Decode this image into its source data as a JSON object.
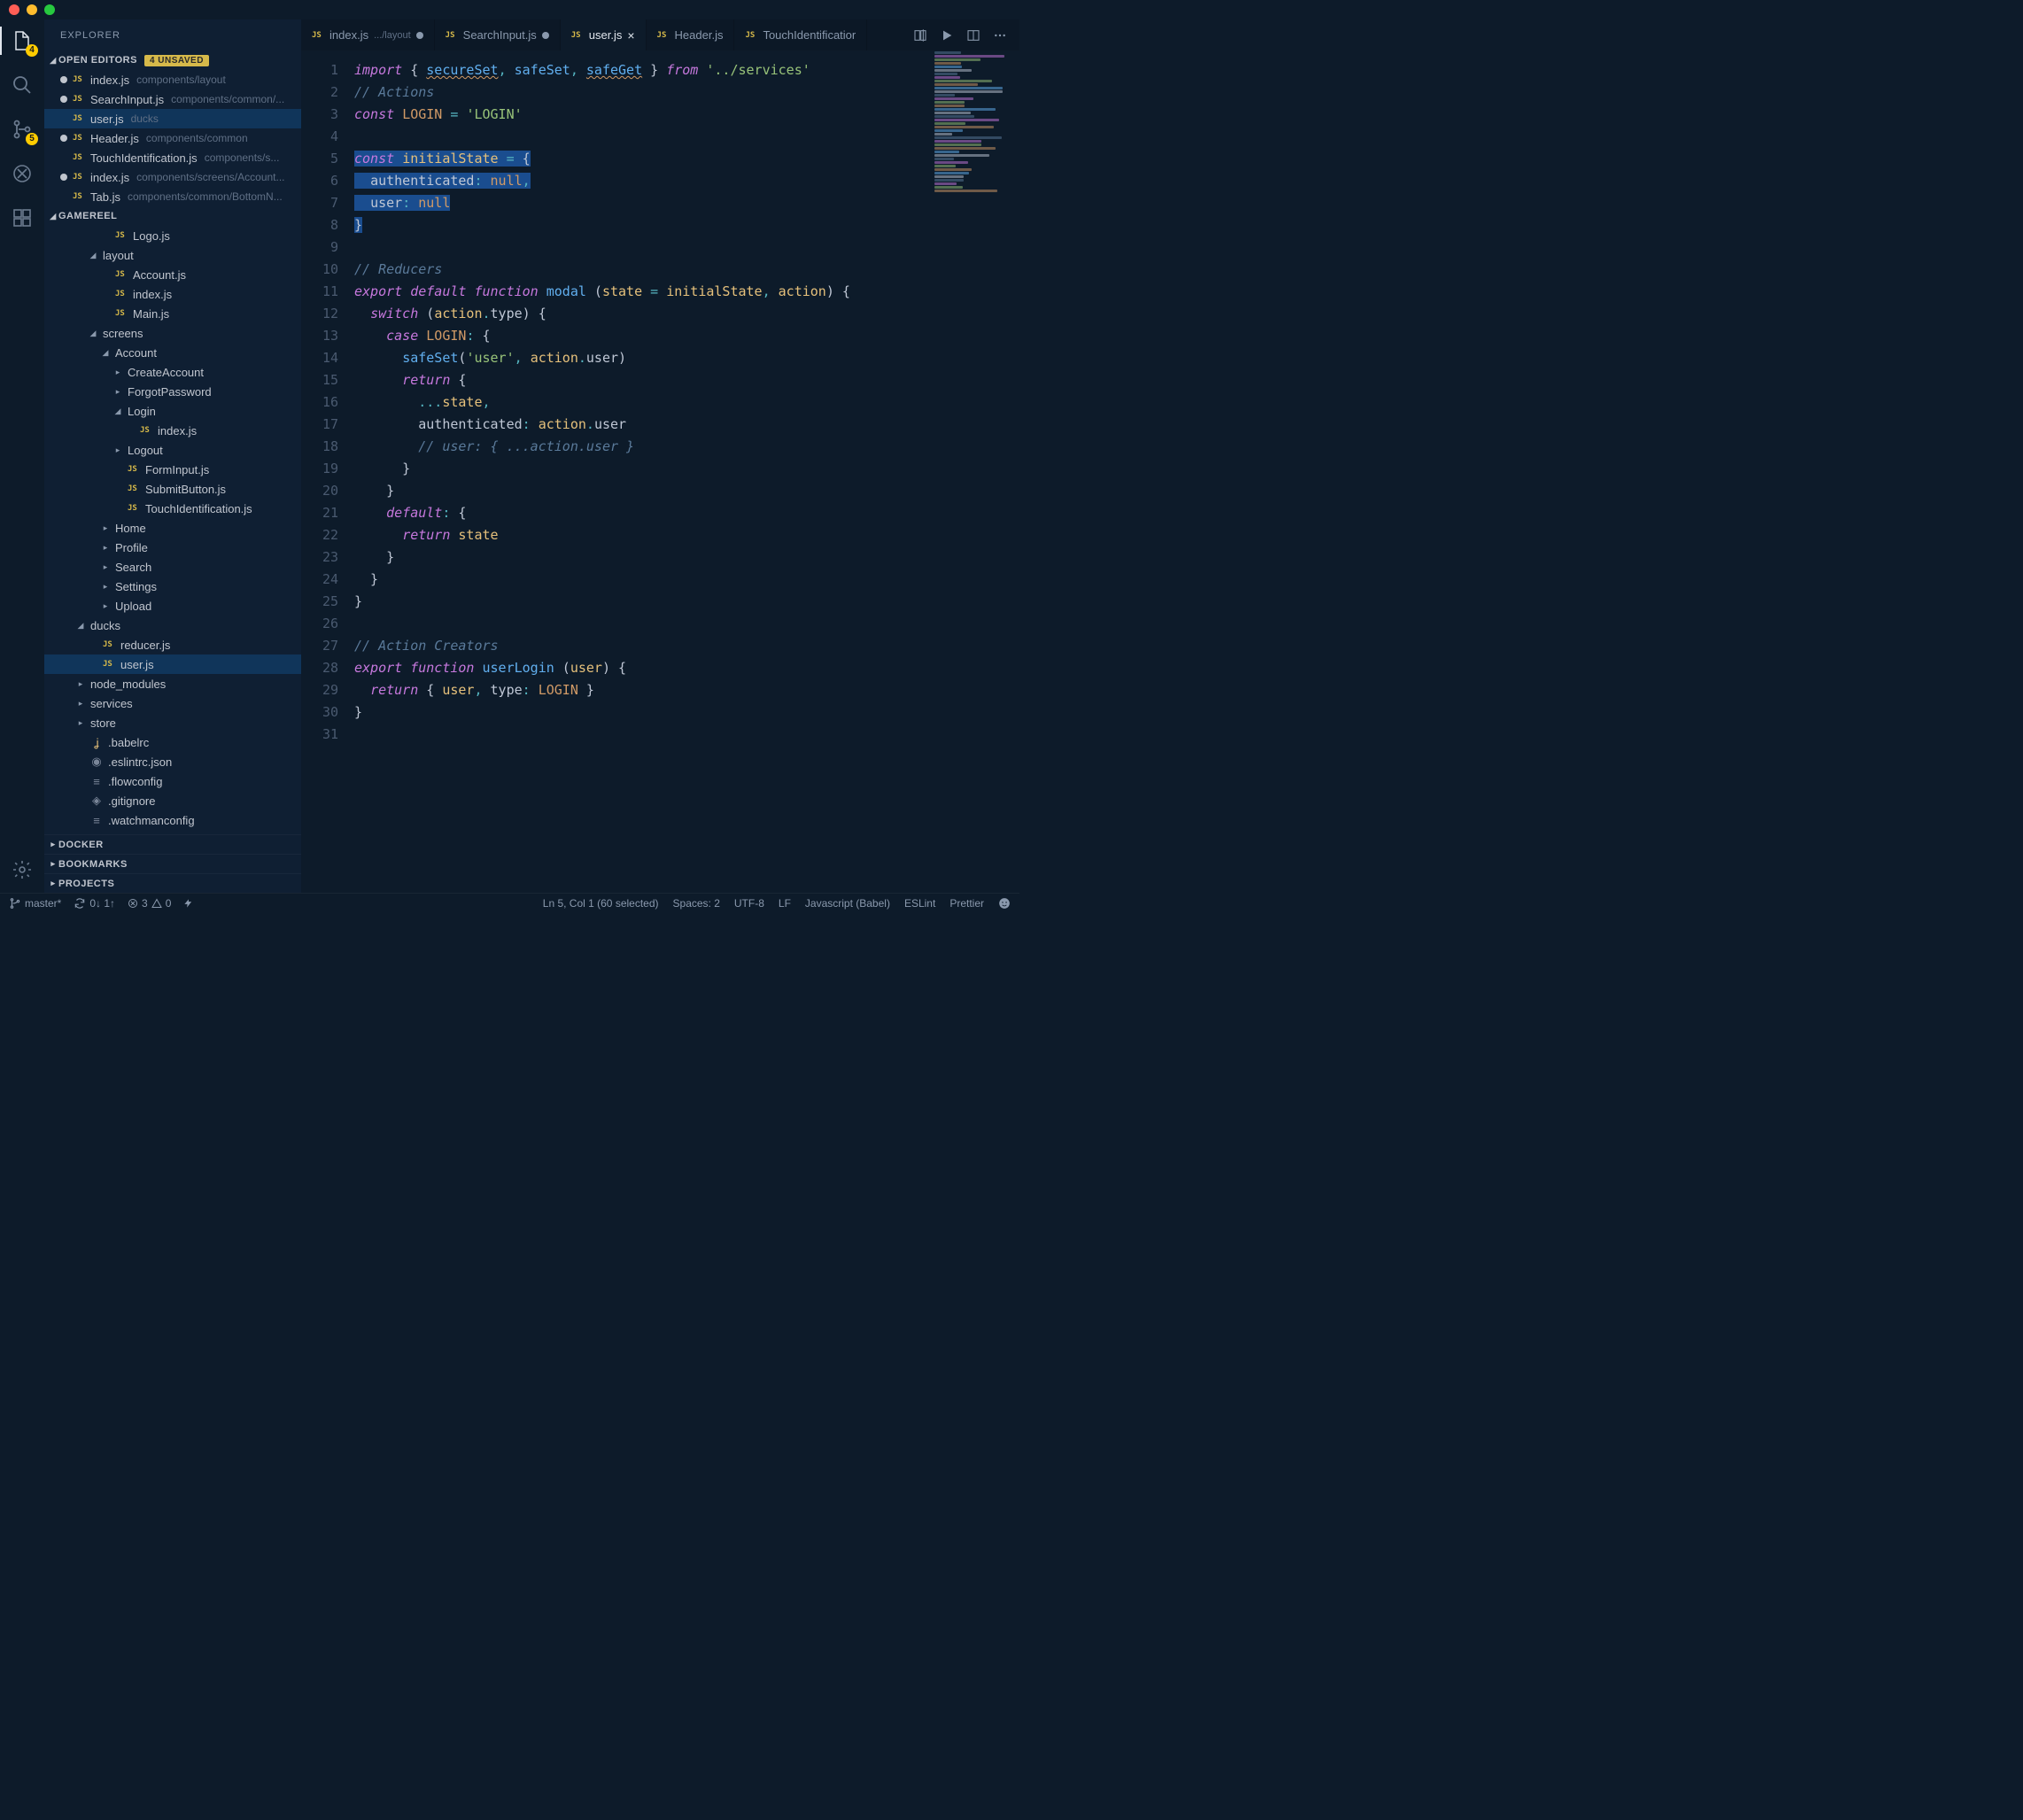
{
  "window": {
    "traffic": [
      "red",
      "yellow",
      "green"
    ]
  },
  "activity": {
    "explorer_badge": "4",
    "scm_badge": "5"
  },
  "sidebar": {
    "title": "EXPLORER",
    "open_editors": {
      "label": "OPEN EDITORS",
      "badge": "4 UNSAVED",
      "items": [
        {
          "dirty": true,
          "name": "index.js",
          "path": "components/layout"
        },
        {
          "dirty": true,
          "name": "SearchInput.js",
          "path": "components/common/..."
        },
        {
          "dirty": false,
          "name": "user.js",
          "path": "ducks",
          "active": true
        },
        {
          "dirty": true,
          "name": "Header.js",
          "path": "components/common"
        },
        {
          "dirty": false,
          "name": "TouchIdentification.js",
          "path": "components/s..."
        },
        {
          "dirty": true,
          "name": "index.js",
          "path": "components/screens/Account..."
        },
        {
          "dirty": false,
          "name": "Tab.js",
          "path": "components/common/BottomN..."
        }
      ]
    },
    "tree_label": "GAMEREEL",
    "tree": [
      {
        "depth": 3,
        "kind": "js",
        "name": "Logo.js"
      },
      {
        "depth": 2,
        "kind": "folder-open",
        "name": "layout"
      },
      {
        "depth": 3,
        "kind": "js",
        "name": "Account.js"
      },
      {
        "depth": 3,
        "kind": "js",
        "name": "index.js"
      },
      {
        "depth": 3,
        "kind": "js",
        "name": "Main.js"
      },
      {
        "depth": 2,
        "kind": "folder-open",
        "name": "screens"
      },
      {
        "depth": 3,
        "kind": "folder-open",
        "name": "Account"
      },
      {
        "depth": 4,
        "kind": "folder",
        "name": "CreateAccount"
      },
      {
        "depth": 4,
        "kind": "folder",
        "name": "ForgotPassword"
      },
      {
        "depth": 4,
        "kind": "folder-open",
        "name": "Login"
      },
      {
        "depth": 5,
        "kind": "js",
        "name": "index.js"
      },
      {
        "depth": 4,
        "kind": "folder",
        "name": "Logout"
      },
      {
        "depth": 4,
        "kind": "js",
        "name": "FormInput.js"
      },
      {
        "depth": 4,
        "kind": "js",
        "name": "SubmitButton.js"
      },
      {
        "depth": 4,
        "kind": "js",
        "name": "TouchIdentification.js"
      },
      {
        "depth": 3,
        "kind": "folder",
        "name": "Home"
      },
      {
        "depth": 3,
        "kind": "folder",
        "name": "Profile"
      },
      {
        "depth": 3,
        "kind": "folder",
        "name": "Search"
      },
      {
        "depth": 3,
        "kind": "folder",
        "name": "Settings"
      },
      {
        "depth": 3,
        "kind": "folder",
        "name": "Upload"
      },
      {
        "depth": 1,
        "kind": "folder-open",
        "name": "ducks"
      },
      {
        "depth": 2,
        "kind": "js",
        "name": "reducer.js"
      },
      {
        "depth": 2,
        "kind": "js",
        "name": "user.js",
        "active": true
      },
      {
        "depth": 1,
        "kind": "folder",
        "name": "node_modules"
      },
      {
        "depth": 1,
        "kind": "folder",
        "name": "services"
      },
      {
        "depth": 1,
        "kind": "folder",
        "name": "store"
      },
      {
        "depth": 1,
        "kind": "file-babel",
        "name": ".babelrc"
      },
      {
        "depth": 1,
        "kind": "file-json",
        "name": ".eslintrc.json"
      },
      {
        "depth": 1,
        "kind": "file",
        "name": ".flowconfig"
      },
      {
        "depth": 1,
        "kind": "file-git",
        "name": ".gitignore"
      },
      {
        "depth": 1,
        "kind": "file",
        "name": ".watchmanconfig"
      }
    ],
    "bottom_sections": [
      "DOCKER",
      "BOOKMARKS",
      "PROJECTS"
    ]
  },
  "tabs": [
    {
      "name": "index.js",
      "sub": ".../layout",
      "dirty": true
    },
    {
      "name": "SearchInput.js",
      "dirty": true
    },
    {
      "name": "user.js",
      "active": true,
      "close": true
    },
    {
      "name": "Header.js"
    },
    {
      "name": "TouchIdentificatior"
    }
  ],
  "editor": {
    "line_start": 1,
    "line_end": 31,
    "lines": [
      [
        [
          "kw",
          "import"
        ],
        [
          "plain",
          " { "
        ],
        [
          "fn wavy",
          "secureSet"
        ],
        [
          "op",
          ", "
        ],
        [
          "fn",
          "safeSet"
        ],
        [
          "op",
          ", "
        ],
        [
          "fn wavy",
          "safeGet"
        ],
        [
          "plain",
          " } "
        ],
        [
          "kw",
          "from"
        ],
        [
          "plain",
          " "
        ],
        [
          "str",
          "'../services'"
        ]
      ],
      [
        [
          "cmt",
          "// Actions"
        ]
      ],
      [
        [
          "kw",
          "const"
        ],
        [
          "plain",
          " "
        ],
        [
          "const",
          "LOGIN"
        ],
        [
          "plain",
          " "
        ],
        [
          "op",
          "="
        ],
        [
          "plain",
          " "
        ],
        [
          "str",
          "'LOGIN'"
        ]
      ],
      [],
      [
        [
          "sel",
          [
            [
              "kw",
              "const"
            ],
            [
              "plain",
              " "
            ],
            [
              "id",
              "initialState"
            ],
            [
              "plain",
              " "
            ],
            [
              "op",
              "="
            ],
            [
              "plain",
              " {"
            ]
          ]
        ]
      ],
      [
        [
          "sel",
          [
            [
              "plain",
              "  "
            ],
            [
              "prop",
              "authenticated"
            ],
            [
              "op",
              ":"
            ],
            [
              "plain",
              " "
            ],
            [
              "null",
              "null"
            ],
            [
              "op",
              ","
            ]
          ]
        ]
      ],
      [
        [
          "sel",
          [
            [
              "plain",
              "  "
            ],
            [
              "prop",
              "user"
            ],
            [
              "op",
              ":"
            ],
            [
              "plain",
              " "
            ],
            [
              "null",
              "null"
            ]
          ]
        ]
      ],
      [
        [
          "sel",
          [
            [
              "plain",
              "}"
            ]
          ]
        ]
      ],
      [],
      [
        [
          "cmt",
          "// Reducers"
        ]
      ],
      [
        [
          "kw",
          "export"
        ],
        [
          "plain",
          " "
        ],
        [
          "kw",
          "default"
        ],
        [
          "plain",
          " "
        ],
        [
          "kw",
          "function"
        ],
        [
          "plain",
          " "
        ],
        [
          "fn",
          "modal"
        ],
        [
          "plain",
          " ("
        ],
        [
          "id",
          "state"
        ],
        [
          "plain",
          " "
        ],
        [
          "op",
          "="
        ],
        [
          "plain",
          " "
        ],
        [
          "id",
          "initialState"
        ],
        [
          "op",
          ","
        ],
        [
          "plain",
          " "
        ],
        [
          "id",
          "action"
        ],
        [
          "plain",
          ") {"
        ]
      ],
      [
        [
          "plain",
          "  "
        ],
        [
          "kw",
          "switch"
        ],
        [
          "plain",
          " ("
        ],
        [
          "id",
          "action"
        ],
        [
          "op",
          "."
        ],
        [
          "prop",
          "type"
        ],
        [
          "plain",
          ") {"
        ]
      ],
      [
        [
          "plain",
          "    "
        ],
        [
          "kw",
          "case"
        ],
        [
          "plain",
          " "
        ],
        [
          "const",
          "LOGIN"
        ],
        [
          "op",
          ":"
        ],
        [
          "plain",
          " {"
        ]
      ],
      [
        [
          "plain",
          "      "
        ],
        [
          "fn",
          "safeSet"
        ],
        [
          "plain",
          "("
        ],
        [
          "str",
          "'user'"
        ],
        [
          "op",
          ","
        ],
        [
          "plain",
          " "
        ],
        [
          "id",
          "action"
        ],
        [
          "op",
          "."
        ],
        [
          "prop",
          "user"
        ],
        [
          "plain",
          ")"
        ]
      ],
      [
        [
          "plain",
          "      "
        ],
        [
          "kw",
          "return"
        ],
        [
          "plain",
          " {"
        ]
      ],
      [
        [
          "plain",
          "        "
        ],
        [
          "op",
          "..."
        ],
        [
          "id",
          "state"
        ],
        [
          "op",
          ","
        ]
      ],
      [
        [
          "plain",
          "        "
        ],
        [
          "prop",
          "authenticated"
        ],
        [
          "op",
          ":"
        ],
        [
          "plain",
          " "
        ],
        [
          "id",
          "action"
        ],
        [
          "op",
          "."
        ],
        [
          "prop",
          "user"
        ]
      ],
      [
        [
          "plain",
          "        "
        ],
        [
          "cmt",
          "// user: { ...action.user }"
        ]
      ],
      [
        [
          "plain",
          "      }"
        ]
      ],
      [
        [
          "plain",
          "    }"
        ]
      ],
      [
        [
          "plain",
          "    "
        ],
        [
          "kw",
          "default"
        ],
        [
          "op",
          ":"
        ],
        [
          "plain",
          " {"
        ]
      ],
      [
        [
          "plain",
          "      "
        ],
        [
          "kw",
          "return"
        ],
        [
          "plain",
          " "
        ],
        [
          "id",
          "state"
        ]
      ],
      [
        [
          "plain",
          "    }"
        ]
      ],
      [
        [
          "plain",
          "  }"
        ]
      ],
      [
        [
          "plain",
          "}"
        ]
      ],
      [],
      [
        [
          "cmt",
          "// Action Creators"
        ]
      ],
      [
        [
          "kw",
          "export"
        ],
        [
          "plain",
          " "
        ],
        [
          "kw",
          "function"
        ],
        [
          "plain",
          " "
        ],
        [
          "fn",
          "userLogin"
        ],
        [
          "plain",
          " ("
        ],
        [
          "id",
          "user"
        ],
        [
          "plain",
          ") {"
        ]
      ],
      [
        [
          "plain",
          "  "
        ],
        [
          "kw",
          "return"
        ],
        [
          "plain",
          " { "
        ],
        [
          "id",
          "user"
        ],
        [
          "op",
          ","
        ],
        [
          "plain",
          " "
        ],
        [
          "prop",
          "type"
        ],
        [
          "op",
          ":"
        ],
        [
          "plain",
          " "
        ],
        [
          "const",
          "LOGIN"
        ],
        [
          "plain",
          " }"
        ]
      ],
      [
        [
          "plain",
          "}"
        ]
      ],
      []
    ]
  },
  "status": {
    "branch": "master*",
    "sync": "0↓ 1↑",
    "errors": "3",
    "warnings": "0",
    "cursor": "Ln 5, Col 1 (60 selected)",
    "spaces": "Spaces: 2",
    "encoding": "UTF-8",
    "eol": "LF",
    "lang": "Javascript (Babel)",
    "eslint": "ESLint",
    "prettier": "Prettier"
  }
}
